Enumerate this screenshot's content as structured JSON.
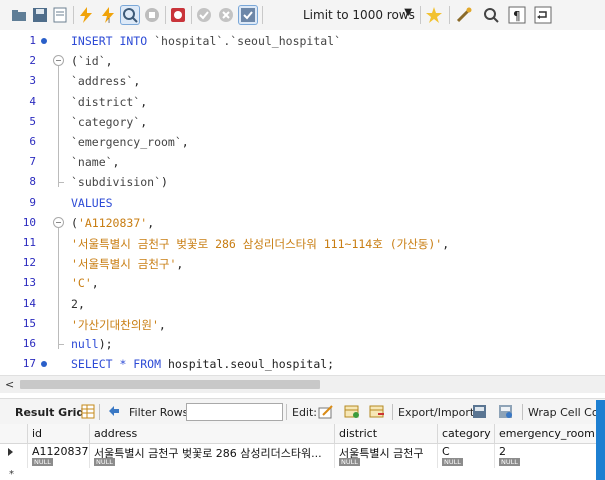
{
  "toolbar": {
    "limit_label": "Limit to 1000 rows",
    "icons": [
      "open-folder-icon",
      "save-icon",
      "sql-file-icon",
      "execute-icon",
      "execute-current-icon",
      "explain-icon",
      "stop-icon",
      "toggle-error-icon",
      "commit-icon",
      "rollback-icon",
      "autocommit-icon",
      "bookmark-icon",
      "beautify-icon",
      "find-icon",
      "invisible-chars-icon",
      "wrap-icon"
    ]
  },
  "editor": {
    "lines": [
      {
        "n": "1",
        "dot": true,
        "fold": false,
        "tokens": [
          {
            "c": "kw",
            "t": "INSERT INTO "
          },
          {
            "c": "bt",
            "t": "`hospital`.`seoul_hospital`"
          }
        ]
      },
      {
        "n": "2",
        "dot": false,
        "fold": true,
        "tokens": [
          {
            "c": "plain",
            "t": "("
          },
          {
            "c": "bt",
            "t": "`id`"
          },
          {
            "c": "plain",
            "t": ","
          }
        ]
      },
      {
        "n": "3",
        "dot": false,
        "fold": false,
        "tokens": [
          {
            "c": "bt",
            "t": "`address`"
          },
          {
            "c": "plain",
            "t": ","
          }
        ]
      },
      {
        "n": "4",
        "dot": false,
        "fold": false,
        "tokens": [
          {
            "c": "bt",
            "t": "`district`"
          },
          {
            "c": "plain",
            "t": ","
          }
        ]
      },
      {
        "n": "5",
        "dot": false,
        "fold": false,
        "tokens": [
          {
            "c": "bt",
            "t": "`category`"
          },
          {
            "c": "plain",
            "t": ","
          }
        ]
      },
      {
        "n": "6",
        "dot": false,
        "fold": false,
        "tokens": [
          {
            "c": "bt",
            "t": "`emergency_room`"
          },
          {
            "c": "plain",
            "t": ","
          }
        ]
      },
      {
        "n": "7",
        "dot": false,
        "fold": false,
        "tokens": [
          {
            "c": "bt",
            "t": "`name`"
          },
          {
            "c": "plain",
            "t": ","
          }
        ]
      },
      {
        "n": "8",
        "dot": false,
        "fold": false,
        "tokens": [
          {
            "c": "bt",
            "t": "`subdivision`"
          },
          {
            "c": "plain",
            "t": ")"
          }
        ]
      },
      {
        "n": "9",
        "dot": false,
        "fold": false,
        "tokens": [
          {
            "c": "kw",
            "t": "VALUES"
          }
        ]
      },
      {
        "n": "10",
        "dot": false,
        "fold": true,
        "tokens": [
          {
            "c": "plain",
            "t": "("
          },
          {
            "c": "str",
            "t": "'A1120837'"
          },
          {
            "c": "plain",
            "t": ","
          }
        ]
      },
      {
        "n": "11",
        "dot": false,
        "fold": false,
        "tokens": [
          {
            "c": "str",
            "t": "'서울특별시 금천구 벚꽃로 286 삼성리더스타워 111~114호 (가산동)'"
          },
          {
            "c": "plain",
            "t": ","
          }
        ]
      },
      {
        "n": "12",
        "dot": false,
        "fold": false,
        "tokens": [
          {
            "c": "str",
            "t": "'서울특별시 금천구'"
          },
          {
            "c": "plain",
            "t": ","
          }
        ]
      },
      {
        "n": "13",
        "dot": false,
        "fold": false,
        "tokens": [
          {
            "c": "str",
            "t": "'C'"
          },
          {
            "c": "plain",
            "t": ","
          }
        ]
      },
      {
        "n": "14",
        "dot": false,
        "fold": false,
        "tokens": [
          {
            "c": "num",
            "t": "2"
          },
          {
            "c": "plain",
            "t": ","
          }
        ]
      },
      {
        "n": "15",
        "dot": false,
        "fold": false,
        "tokens": [
          {
            "c": "str",
            "t": "'가산기대찬의원'"
          },
          {
            "c": "plain",
            "t": ","
          }
        ]
      },
      {
        "n": "16",
        "dot": false,
        "fold": false,
        "tokens": [
          {
            "c": "kw",
            "t": "null"
          },
          {
            "c": "plain",
            "t": ");"
          }
        ]
      },
      {
        "n": "17",
        "dot": true,
        "fold": false,
        "tokens": [
          {
            "c": "kw",
            "t": "SELECT * FROM "
          },
          {
            "c": "plain",
            "t": "hospital.seoul_hospital;"
          }
        ]
      }
    ]
  },
  "result_bar": {
    "result_grid": "Result Grid",
    "filter_rows": "Filter Rows:",
    "edit": "Edit:",
    "export_import": "Export/Import:",
    "wrap_cell": "Wrap Cell Cont"
  },
  "grid": {
    "columns": [
      "id",
      "address",
      "district",
      "category",
      "emergency_room"
    ],
    "rows": [
      {
        "cells": [
          "A1120837",
          "서울특별시 금천구 벚꽃로 286 삼성리더스타워...",
          "서울특별시 금천구",
          "C",
          "2"
        ],
        "null_label": "NULL"
      }
    ],
    "new_row_marker": "*"
  }
}
